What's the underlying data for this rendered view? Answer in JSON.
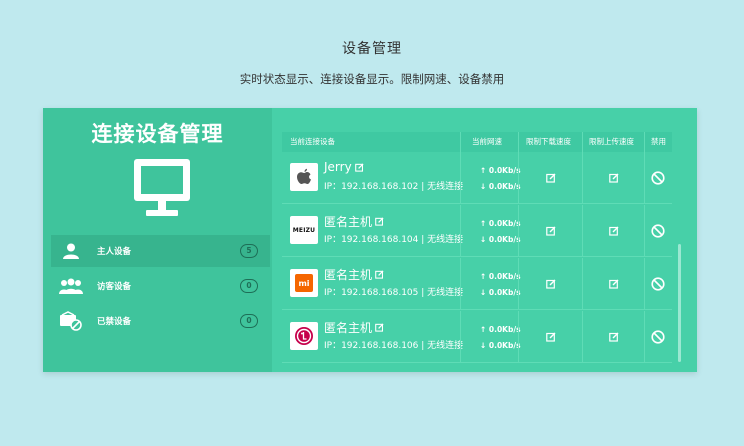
{
  "page": {
    "title": "设备管理",
    "subtitle": "实时状态显示、连接设备显示。限制网速、设备禁用"
  },
  "sidebar": {
    "title": "连接设备管理",
    "items": [
      {
        "label": "主人设备",
        "count": "5",
        "icon": "user-icon"
      },
      {
        "label": "访客设备",
        "count": "0",
        "icon": "users-icon"
      },
      {
        "label": "已禁设备",
        "count": "0",
        "icon": "blocked-device-icon"
      }
    ]
  },
  "table": {
    "headers": {
      "device": "当前连接设备",
      "speed": "当前网速",
      "download_limit": "限制下载速度",
      "upload_limit": "限制上传速度",
      "ban": "禁用"
    },
    "rows": [
      {
        "name": "Jerry",
        "ip": "IP：192.168.168.102 | 无线连接",
        "up": "↑ 0.0Kb/s",
        "down": "↓ 0.0Kb/s",
        "brand": "apple-logo-icon"
      },
      {
        "name": "匿名主机",
        "ip": "IP：192.168.168.104 | 无线连接",
        "up": "↑ 0.0Kb/s",
        "down": "↓ 0.0Kb/s",
        "brand": "meizu-logo-icon",
        "brand_text": "MEIZU"
      },
      {
        "name": "匿名主机",
        "ip": "IP：192.168.168.105 | 无线连接",
        "up": "↑ 0.0Kb/s",
        "down": "↓ 0.0Kb/s",
        "brand": "mi-logo-icon",
        "brand_text": "mi"
      },
      {
        "name": "匿名主机",
        "ip": "IP：192.168.168.106 | 无线连接",
        "up": "↑ 0.0Kb/s",
        "down": "↓ 0.0Kb/s",
        "brand": "lg-logo-icon"
      }
    ]
  },
  "colors": {
    "background": "#bfe9ee",
    "card": "#47d0a8",
    "sidebar": "#3fc49c",
    "active": "#37b48e",
    "mi_orange": "#f56600",
    "lg_red": "#c6004b"
  }
}
